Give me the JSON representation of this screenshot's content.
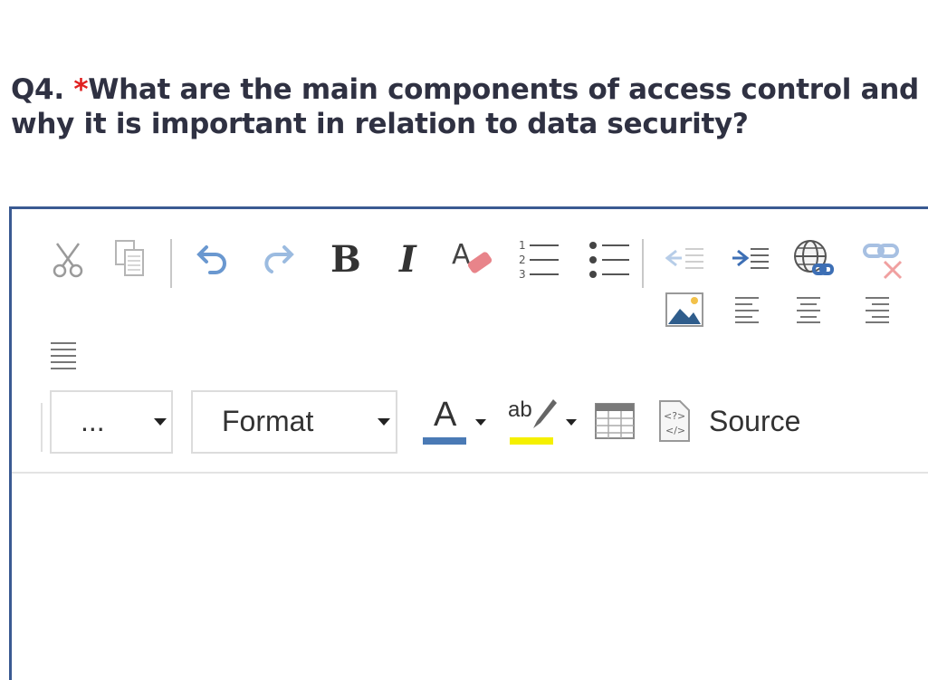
{
  "question": {
    "number": "Q4.",
    "required_mark": "*",
    "text": "What are the main components of access control and why it is important in relation to data security?"
  },
  "toolbar": {
    "icons": [
      "cut-icon",
      "copy-icon",
      "undo-icon",
      "redo-icon",
      "bold-icon",
      "italic-icon",
      "remove-format-icon",
      "numbered-list-icon",
      "bulleted-list-icon",
      "outdent-icon",
      "indent-icon",
      "link-icon",
      "unlink-icon",
      "image-icon",
      "align-left-icon",
      "align-center-icon",
      "align-right-icon",
      "justify-icon"
    ],
    "bold_label": "B",
    "italic_label": "I",
    "styles_value": "...",
    "format_value": "Format",
    "text_color_label": "A",
    "bg_color_label": "ab",
    "source_label": "Source",
    "colors": {
      "text_color": "#4a7ab5",
      "bg_color": "#f5f000",
      "accent": "#3a5a92"
    }
  }
}
